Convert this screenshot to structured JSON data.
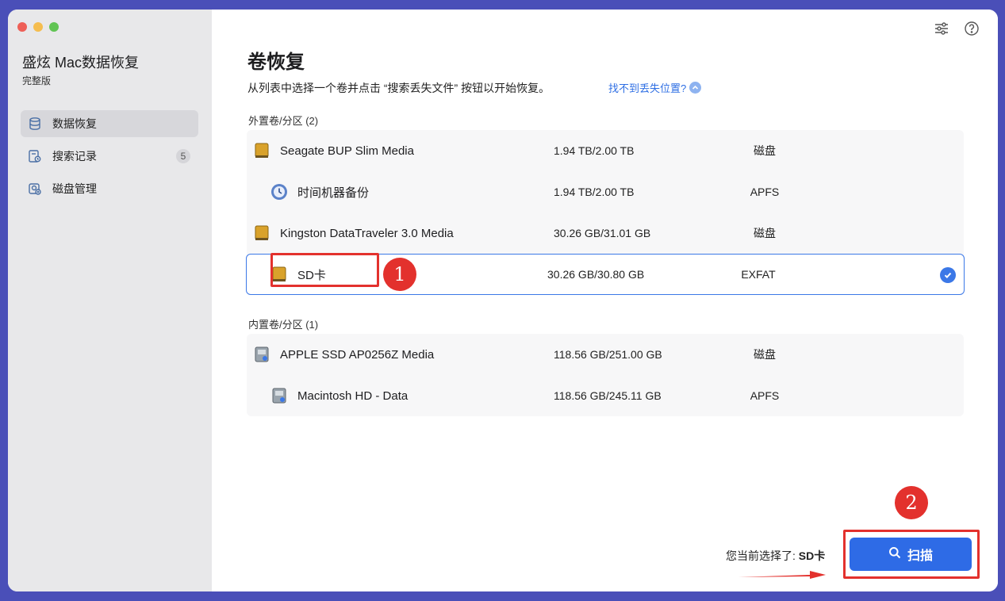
{
  "sidebar": {
    "app_name": "盛炫 Mac数据恢复",
    "edition": "完整版",
    "items": [
      {
        "label": "数据恢复",
        "icon": "database-icon",
        "active": true
      },
      {
        "label": "搜索记录",
        "icon": "search-history-icon",
        "badge": "5"
      },
      {
        "label": "磁盘管理",
        "icon": "disk-management-icon"
      }
    ]
  },
  "header": {
    "title": "卷恢复",
    "subtitle": "从列表中选择一个卷并点击 “搜索丢失文件” 按钮以开始恢复。",
    "help_link": "找不到丢失位置?"
  },
  "external": {
    "label": "外置卷/分区 (2)",
    "rows": [
      {
        "name": "Seagate BUP Slim Media",
        "size": "1.94 TB/2.00 TB",
        "fs": "磁盘",
        "icon": "external-drive-icon"
      },
      {
        "name": "时间机器备份",
        "size": "1.94 TB/2.00 TB",
        "fs": "APFS",
        "icon": "time-machine-icon"
      },
      {
        "name": "Kingston DataTraveler 3.0 Media",
        "size": "30.26 GB/31.01 GB",
        "fs": "磁盘",
        "icon": "external-drive-icon"
      },
      {
        "name": "SD卡",
        "size": "30.26 GB/30.80 GB",
        "fs": "EXFAT",
        "icon": "external-drive-icon",
        "selected": true
      }
    ]
  },
  "internal": {
    "label": "内置卷/分区 (1)",
    "rows": [
      {
        "name": "APPLE SSD AP0256Z Media",
        "size": "118.56 GB/251.00 GB",
        "fs": "磁盘",
        "icon": "internal-disk-icon"
      },
      {
        "name": "Macintosh HD - Data",
        "size": "118.56 GB/245.11 GB",
        "fs": "APFS",
        "icon": "internal-disk-icon"
      }
    ]
  },
  "footer": {
    "current_prefix": "您当前选择了:",
    "current_value": "SD卡",
    "scan_label": "扫描"
  },
  "annotations": {
    "step1": "1",
    "step2": "2"
  },
  "colors": {
    "accent": "#2e6be6",
    "annotation": "#e3312d",
    "sidebar_bg": "#e8e8ea"
  }
}
